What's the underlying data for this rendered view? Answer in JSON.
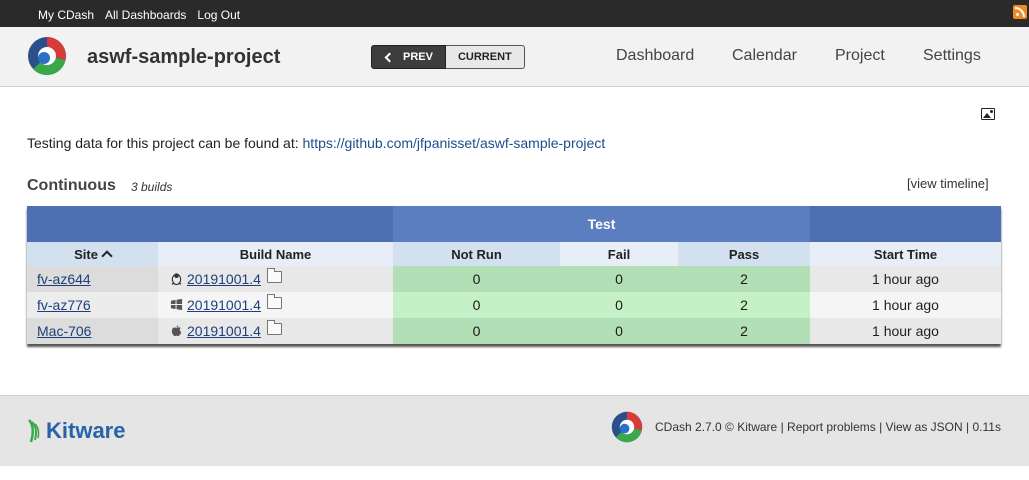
{
  "topbar": {
    "links": [
      "My CDash",
      "All Dashboards",
      "Log Out"
    ]
  },
  "header": {
    "project_name": "aswf-sample-project",
    "prev_label": "PREV",
    "current_label": "CURRENT",
    "nav": [
      "Dashboard",
      "Calendar",
      "Project",
      "Settings"
    ]
  },
  "info": {
    "prefix": "Testing data for this project can be found at: ",
    "link": "https://github.com/jfpanisset/aswf-sample-project"
  },
  "group": {
    "title": "Continuous",
    "count": "3 builds",
    "timeline_link": "[view timeline]"
  },
  "table": {
    "group_header": "Test",
    "columns": [
      "Site",
      "Build Name",
      "Not Run",
      "Fail",
      "Pass",
      "Start Time"
    ],
    "rows": [
      {
        "site": "fv-az644",
        "os": "linux-icon",
        "build": "20191001.4",
        "not_run": "0",
        "fail": "0",
        "pass": "2",
        "start": "1 hour ago"
      },
      {
        "site": "fv-az776",
        "os": "windows-icon",
        "build": "20191001.4",
        "not_run": "0",
        "fail": "0",
        "pass": "2",
        "start": "1 hour ago"
      },
      {
        "site": "Mac-706",
        "os": "apple-icon",
        "build": "20191001.4",
        "not_run": "0",
        "fail": "0",
        "pass": "2",
        "start": "1 hour ago"
      }
    ]
  },
  "footer": {
    "brand": "Kitware",
    "version_text": "CDash 2.7.0 © Kitware",
    "report_link": "Report problems",
    "json_link": "View as JSON",
    "timing": "0.11s"
  },
  "colors": {
    "topbar": "#2a2a2a",
    "table_header": "#5b7ec1",
    "pass_green": "#b2dfb6",
    "link": "#1e4d8f"
  }
}
